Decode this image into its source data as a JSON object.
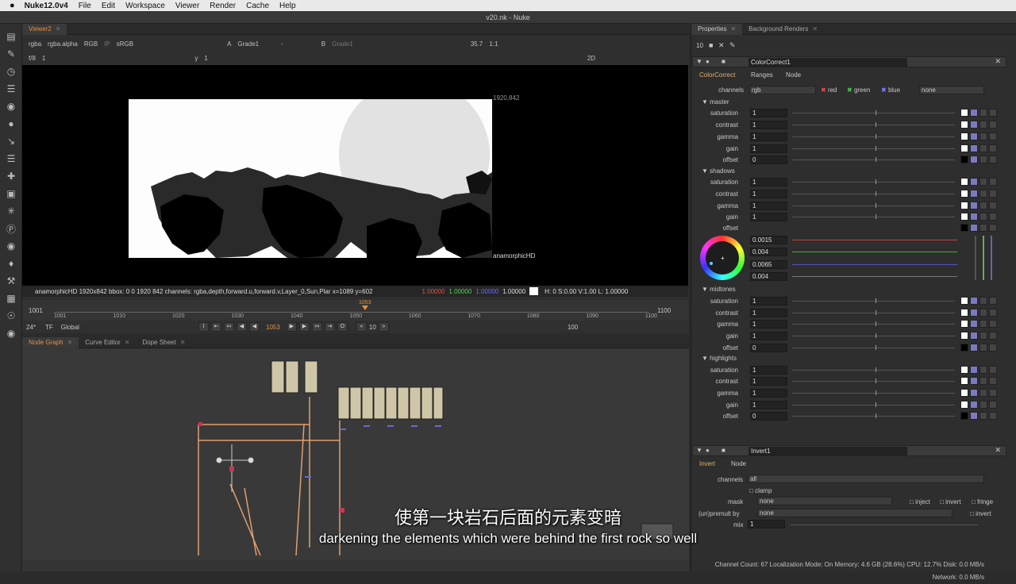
{
  "menubar": {
    "apple": "",
    "app": "Nuke12.0v4",
    "items": [
      "File",
      "Edit",
      "Workspace",
      "Viewer",
      "Render",
      "Cache",
      "Help"
    ]
  },
  "window_title": "v20.nk - Nuke",
  "viewer": {
    "tab": "Viewer2",
    "row1": {
      "layer": "rgba",
      "alpha": "rgba.alpha",
      "mode": "RGB",
      "ip": "IP",
      "lut": "sRGB",
      "input_a_label": "A",
      "input_a": "Grade1",
      "dash": "-",
      "input_b_label": "B",
      "input_b": "Grade1",
      "zoom": "35.7",
      "scale": "1:1"
    },
    "row2": {
      "fstop": "f/8",
      "gain": "1",
      "y_label": "y",
      "gamma": "1",
      "view": "2D"
    },
    "resolution_label": "1920,842",
    "format_label": "anamorphicHD",
    "status": "anamorphicHD 1920x842  bbox: 0 0 1920 842 channels: rgba,depth,forward.u,forward.v,Layer_0,Sun,Plar  x=1089 y=602",
    "rgba": {
      "r": "1.00000",
      "g": "1.00000",
      "b": "1.00000",
      "a": "1.00000"
    },
    "hsv": "H: 0 S:0.00 V:1.00   L: 1.00000"
  },
  "timeline": {
    "start": "1001",
    "end": "1100",
    "ticks": [
      "1001",
      "1010",
      "1020",
      "1030",
      "1040",
      "1050",
      "1060",
      "1070",
      "1080",
      "1090",
      "1100"
    ],
    "current": "1053"
  },
  "playbar": {
    "fps": "24*",
    "tf": "TF",
    "scope": "Global",
    "frame": "1053",
    "step": "10",
    "end": "100"
  },
  "graph_tabs": [
    "Node Graph",
    "Curve Editor",
    "Dope Sheet"
  ],
  "props": {
    "tabs": [
      "Properties",
      "Background Renders"
    ],
    "max_panels": "10",
    "node1": {
      "name": "ColorCorrect1",
      "tabs": [
        "ColorCorrect",
        "Ranges",
        "Node"
      ],
      "channels_label": "channels",
      "channels": "rgb",
      "red": "red",
      "green": "green",
      "blue": "blue",
      "extra": "none"
    },
    "sections": {
      "master": {
        "title": "master",
        "knobs": [
          [
            "saturation",
            "1"
          ],
          [
            "contrast",
            "1"
          ],
          [
            "gamma",
            "1"
          ],
          [
            "gain",
            "1"
          ],
          [
            "offset",
            "0"
          ]
        ]
      },
      "shadows": {
        "title": "shadows",
        "knobs": [
          [
            "saturation",
            "1"
          ],
          [
            "contrast",
            "1"
          ],
          [
            "gamma",
            "1"
          ],
          [
            "gain",
            "1"
          ],
          [
            "offset",
            ""
          ]
        ]
      },
      "shadow_offset": [
        "0.0015",
        "0.004",
        "0.0065",
        "0.004"
      ],
      "midtones": {
        "title": "midtones",
        "knobs": [
          [
            "saturation",
            "1"
          ],
          [
            "contrast",
            "1"
          ],
          [
            "gamma",
            "1"
          ],
          [
            "gain",
            "1"
          ],
          [
            "offset",
            "0"
          ]
        ]
      },
      "highlights": {
        "title": "highlights",
        "knobs": [
          [
            "saturation",
            "1"
          ],
          [
            "contrast",
            "1"
          ],
          [
            "gamma",
            "1"
          ],
          [
            "gain",
            "1"
          ],
          [
            "offset",
            "0"
          ]
        ]
      }
    },
    "node2": {
      "name": "Invert1",
      "tabs": [
        "Invert",
        "Node"
      ],
      "channels_label": "channels",
      "channels": "all",
      "clamp": "clamp",
      "mask_label": "mask",
      "mask": "none",
      "inject": "inject",
      "invert": "invert",
      "fringe": "fringe",
      "premult_label": "(un)premult by",
      "premult": "none",
      "premult_invert": "invert",
      "mix_label": "mix",
      "mix": "1"
    }
  },
  "subtitles": {
    "zh": "使第一块岩石后面的元素变暗",
    "en": "darkening the elements which were behind the first rock so well"
  },
  "statusbar": "Channel Count: 67  Localization Mode: On  Memory: 4.6 GB (28.6%)  CPU: 12.7%  Disk: 0.0 MB/s  Network: 0.0 MB/s"
}
